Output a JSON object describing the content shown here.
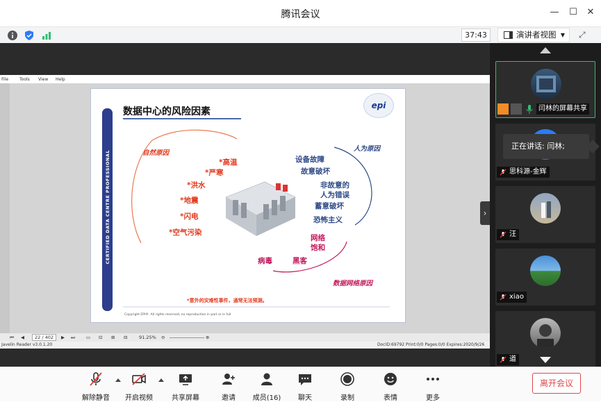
{
  "window": {
    "title": "腾讯会议"
  },
  "statusbar": {
    "timer": "37:43",
    "view_label": "演讲者视图"
  },
  "pdf": {
    "menu": [
      "File",
      "Tools",
      "View",
      "Help"
    ],
    "page_indicator": "22 / 402",
    "zoom": "91.25%",
    "app_version": "Javelin Reader v3.0.1.20",
    "status_info": "DocID:69792 Print:0/0 Pages:0/0 Expires:2020/9/26"
  },
  "slide": {
    "title": "数据中心的风险因素",
    "side_text": "CERTIFIED DATA CENTRE PROFESSIONAL",
    "logo": "epi",
    "categories": {
      "natural": "自然原因",
      "human": "人为原因",
      "network": "数据网络原因"
    },
    "natural_risks": [
      "*高温",
      "*严寒",
      "*洪水",
      "*地震",
      "*闪电",
      "*空气污染"
    ],
    "human_risks": [
      "设备故障",
      "故意破坏",
      "非故意的",
      "人为错误",
      "蓄意破坏",
      "恐怖主义"
    ],
    "network_risks": [
      "网络",
      "饱和",
      "病毒",
      "黑客"
    ],
    "footnote": "*意外的灾难性事件，通常无法预测。",
    "copyright": "Copyright EPI®. All rights reserved, no reproduction in part or in full"
  },
  "participants": [
    {
      "name": "闫林的屏幕共享",
      "active": true
    },
    {
      "name": "思科源-金辉",
      "active": false
    },
    {
      "name": "汪",
      "active": false
    },
    {
      "name": "xiao",
      "active": false
    },
    {
      "name": "道",
      "active": false
    }
  ],
  "speaking": "正在讲话: 闫林;",
  "toolbar": {
    "mute": "解除静音",
    "video": "开启视频",
    "share": "共享屏幕",
    "invite": "邀请",
    "members": "成员(16)",
    "chat": "聊天",
    "record": "录制",
    "emoji": "表情",
    "more": "更多",
    "leave": "离开会议"
  }
}
